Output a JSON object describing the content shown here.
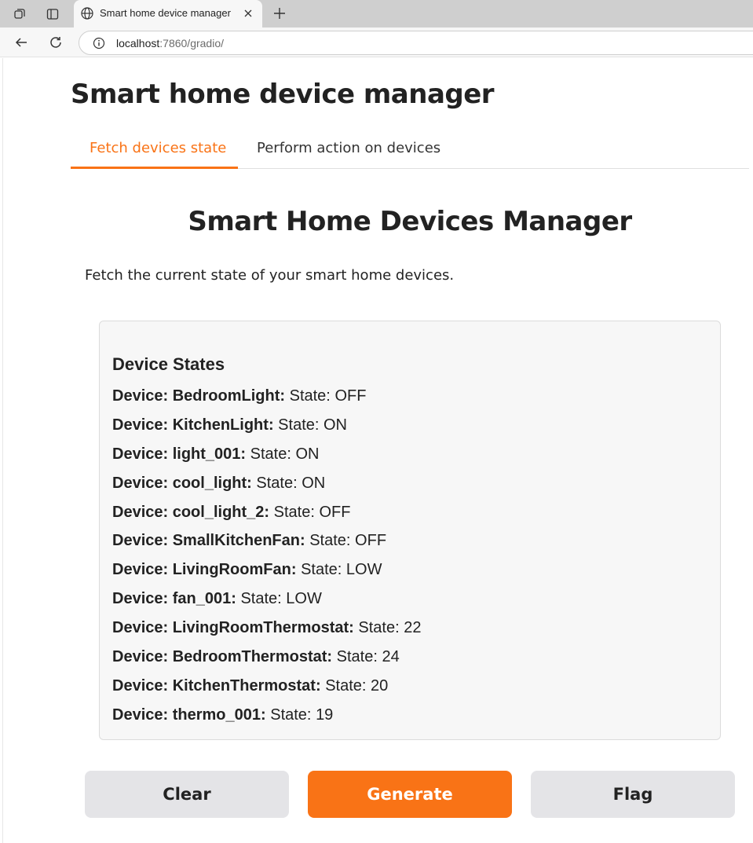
{
  "browser": {
    "tab_title": "Smart home device manager",
    "url_host": "localhost",
    "url_rest": ":7860/gradio/"
  },
  "app": {
    "title": "Smart home device manager",
    "tabs": [
      {
        "label": "Fetch devices state",
        "active": true
      },
      {
        "label": "Perform action on devices",
        "active": false
      }
    ],
    "heading": "Smart Home Devices Manager",
    "description": "Fetch the current state of your smart home devices.",
    "output": {
      "title": "Device States",
      "device_prefix": "Device:",
      "state_prefix": "State:",
      "devices": [
        {
          "name": "BedroomLight",
          "state": "OFF"
        },
        {
          "name": "KitchenLight",
          "state": "ON"
        },
        {
          "name": "light_001",
          "state": "ON"
        },
        {
          "name": "cool_light",
          "state": "ON"
        },
        {
          "name": "cool_light_2",
          "state": "OFF"
        },
        {
          "name": "SmallKitchenFan",
          "state": "OFF"
        },
        {
          "name": "LivingRoomFan",
          "state": "LOW"
        },
        {
          "name": "fan_001",
          "state": "LOW"
        },
        {
          "name": "LivingRoomThermostat",
          "state": "22"
        },
        {
          "name": "BedroomThermostat",
          "state": "24"
        },
        {
          "name": "KitchenThermostat",
          "state": "20"
        },
        {
          "name": "thermo_001",
          "state": "19"
        }
      ]
    },
    "buttons": {
      "clear": "Clear",
      "generate": "Generate",
      "flag": "Flag"
    }
  },
  "colors": {
    "accent": "#f97316",
    "secondary_button": "#e4e4e7",
    "output_bg": "#f7f7f7"
  }
}
